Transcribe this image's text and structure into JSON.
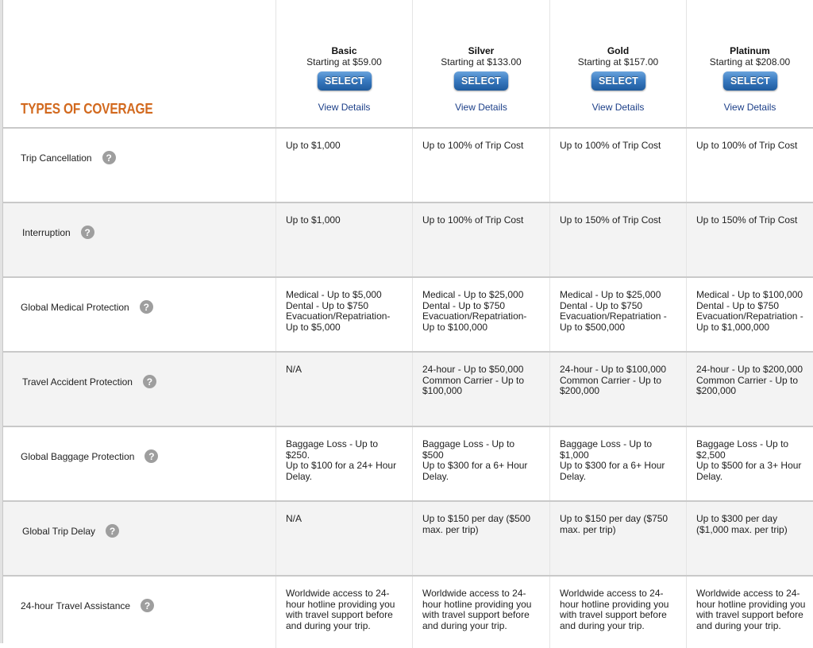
{
  "coverage_title": "TYPES OF COVERAGE",
  "plans": [
    {
      "name": "Basic",
      "price": "Starting at $59.00",
      "select_label": "SELECT",
      "details_label": "View Details"
    },
    {
      "name": "Silver",
      "price": "Starting at $133.00",
      "select_label": "SELECT",
      "details_label": "View Details"
    },
    {
      "name": "Gold",
      "price": "Starting at $157.00",
      "select_label": "SELECT",
      "details_label": "View Details"
    },
    {
      "name": "Platinum",
      "price": "Starting at $208.00",
      "select_label": "SELECT",
      "details_label": "View Details"
    }
  ],
  "help_icon_glyph": "?",
  "rows": [
    {
      "label": "Trip Cancellation",
      "values": [
        "Up to $1,000",
        "Up to 100% of Trip Cost",
        "Up to 100% of Trip Cost",
        "Up to 100% of Trip Cost"
      ]
    },
    {
      "label": "Interruption",
      "values": [
        "Up to $1,000",
        "Up to 100% of Trip Cost",
        "Up to 150% of Trip Cost",
        "Up to 150% of Trip Cost"
      ]
    },
    {
      "label": "Global Medical Protection",
      "values": [
        "Medical - Up to $5,000\nDental - Up to $750\nEvacuation/Repatriation-\nUp to $5,000",
        "Medical - Up to $25,000\nDental - Up to $750\nEvacuation/Repatriation-\nUp to $100,000",
        "Medical - Up to $25,000\nDental - Up to $750\nEvacuation/Repatriation -\nUp to $500,000",
        "Medical - Up to $100,000\nDental - Up to $750\nEvacuation/Repatriation -\nUp to $1,000,000"
      ]
    },
    {
      "label": "Travel Accident Protection",
      "values": [
        "N/A",
        "24-hour - Up to $50,000\nCommon Carrier - Up to\n$100,000",
        "24-hour - Up to $100,000\nCommon Carrier - Up to\n$200,000",
        "24-hour - Up to $200,000\nCommon Carrier - Up to\n$200,000"
      ]
    },
    {
      "label": "Global Baggage Protection",
      "values": [
        "Baggage Loss - Up to\n$250.\nUp to $100 for a 24+ Hour\nDelay.",
        "Baggage Loss - Up to\n$500\nUp to $300 for a 6+ Hour\nDelay.",
        "Baggage Loss - Up to\n$1,000\nUp to $300 for a 6+ Hour\nDelay.",
        "Baggage Loss - Up to\n$2,500\nUp to $500 for a 3+ Hour\nDelay."
      ]
    },
    {
      "label": "Global Trip Delay",
      "values": [
        "N/A",
        "Up to $150 per day ($500\nmax. per trip)",
        "Up to $150 per day ($750\nmax. per trip)",
        "Up to $300 per day\n($1,000 max. per trip)"
      ]
    },
    {
      "label": "24-hour Travel Assistance",
      "values": [
        "Worldwide access to 24-\nhour hotline providing you\nwith travel support before\nand during your trip.",
        "Worldwide access to 24-\nhour hotline providing you\nwith travel support before\nand during your trip.",
        "Worldwide access to 24-\nhour hotline providing you\nwith travel support before\nand during your trip.",
        "Worldwide access to 24-\nhour hotline providing you\nwith travel support before\nand during your trip."
      ]
    }
  ],
  "colors": {
    "accent_orange": "#d2691e",
    "link_blue": "#1c3f88",
    "button_blue": "#3a7bc1",
    "alt_row": "#f3f3f3",
    "help_icon": "#9e9e9e"
  }
}
